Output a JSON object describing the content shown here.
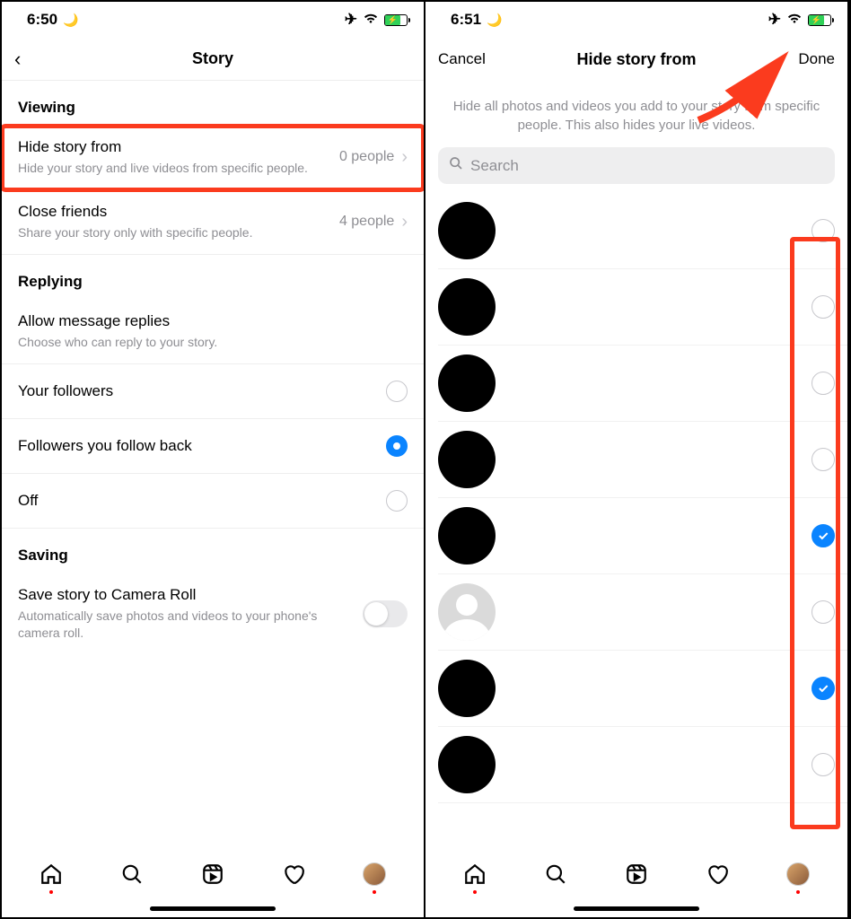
{
  "left": {
    "status": {
      "time": "6:50"
    },
    "nav": {
      "title": "Story"
    },
    "sections": {
      "viewing": {
        "header": "Viewing",
        "hide": {
          "title": "Hide story from",
          "sub": "Hide your story and live videos from specific people.",
          "value": "0 people"
        },
        "close": {
          "title": "Close friends",
          "sub": "Share your story only with specific people.",
          "value": "4 people"
        }
      },
      "replying": {
        "header": "Replying",
        "allow": {
          "title": "Allow message replies",
          "sub": "Choose who can reply to your story."
        },
        "opt_followers": "Your followers",
        "opt_followback": "Followers you follow back",
        "opt_off": "Off"
      },
      "saving": {
        "header": "Saving",
        "save": {
          "title": "Save story to Camera Roll",
          "sub": "Automatically save photos and videos to your phone's camera roll."
        }
      }
    }
  },
  "right": {
    "status": {
      "time": "6:51"
    },
    "nav": {
      "cancel": "Cancel",
      "title": "Hide story from",
      "done": "Done"
    },
    "description": "Hide all photos and videos you add to your story from specific people. This also hides your live videos.",
    "search_placeholder": "Search",
    "users": [
      {
        "avatar": "black",
        "checked": false
      },
      {
        "avatar": "black",
        "checked": false
      },
      {
        "avatar": "black",
        "checked": false
      },
      {
        "avatar": "black",
        "checked": false
      },
      {
        "avatar": "black",
        "checked": true
      },
      {
        "avatar": "placeholder",
        "checked": false
      },
      {
        "avatar": "black",
        "checked": true
      },
      {
        "avatar": "black",
        "checked": false
      }
    ]
  }
}
